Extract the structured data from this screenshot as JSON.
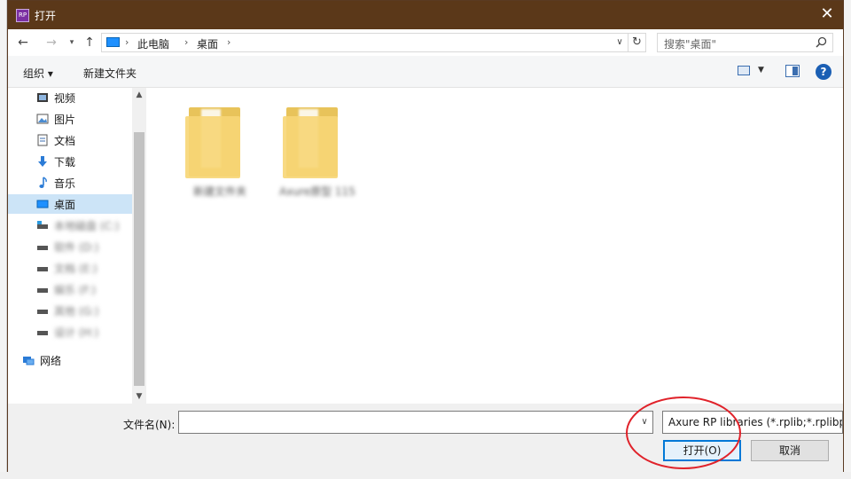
{
  "dialog": {
    "title": "打开",
    "app_icon_text": "RP",
    "close_icon": "close-icon"
  },
  "address": {
    "root_icon": "this-pc-icon",
    "crumbs": [
      "此电脑",
      "桌面"
    ],
    "refresh_icon": "refresh-icon"
  },
  "search": {
    "placeholder": "搜索\"桌面\"",
    "icon": "search-icon"
  },
  "toolbar": {
    "organize_label": "组织 ▾",
    "new_folder_label": "新建文件夹",
    "help_label": "?"
  },
  "nav": {
    "items": [
      {
        "label": "视频",
        "icon": "video-icon",
        "selected": false,
        "blurred": false
      },
      {
        "label": "图片",
        "icon": "pictures-icon",
        "selected": false,
        "blurred": false
      },
      {
        "label": "文档",
        "icon": "documents-icon",
        "selected": false,
        "blurred": false
      },
      {
        "label": "下载",
        "icon": "download-icon",
        "selected": false,
        "blurred": false
      },
      {
        "label": "音乐",
        "icon": "music-icon",
        "selected": false,
        "blurred": false
      },
      {
        "label": "桌面",
        "icon": "desktop-icon",
        "selected": true,
        "blurred": false
      },
      {
        "label": "本地磁盘 (C:)",
        "icon": "drive-icon",
        "selected": false,
        "blurred": true
      },
      {
        "label": "软件 (D:)",
        "icon": "drive-icon",
        "selected": false,
        "blurred": true
      },
      {
        "label": "文档 (E:)",
        "icon": "drive-icon",
        "selected": false,
        "blurred": true
      },
      {
        "label": "娱乐 (F:)",
        "icon": "drive-icon",
        "selected": false,
        "blurred": true
      },
      {
        "label": "其他 (G:)",
        "icon": "drive-icon",
        "selected": false,
        "blurred": true
      },
      {
        "label": "设计 (H:)",
        "icon": "drive-icon",
        "selected": false,
        "blurred": true
      },
      {
        "label": "网络",
        "icon": "network-icon",
        "selected": false,
        "blurred": false
      }
    ]
  },
  "content": {
    "folders": [
      {
        "label": "新建文件夹"
      },
      {
        "label": "Axure原型 115"
      }
    ]
  },
  "bottom": {
    "filename_label": "文件名(N):",
    "filename_value": "",
    "filter_value": "Axure RP libraries (*.rplib;*.rplibprj)",
    "open_label": "打开(O)",
    "cancel_label": "取消"
  }
}
